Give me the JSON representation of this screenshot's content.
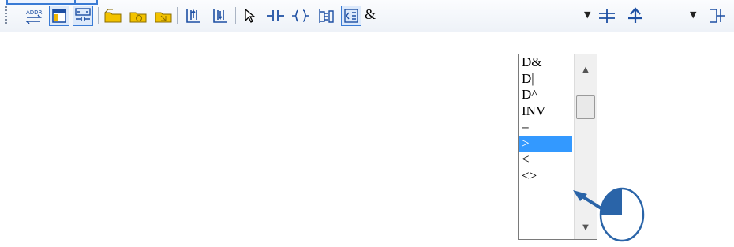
{
  "toolbar": {
    "buttons": [
      {
        "name": "addr-toggle-icon",
        "glyph": "⇆"
      },
      {
        "name": "window-icon",
        "glyph": "▣"
      },
      {
        "name": "contact-coil-icon",
        "glyph": "⊞"
      },
      {
        "name": "folder-icon",
        "glyph": "▰"
      },
      {
        "name": "folder-up-icon",
        "glyph": "▰"
      },
      {
        "name": "folder-down-icon",
        "glyph": "▰"
      },
      {
        "name": "insert-rung-above-icon",
        "glyph": "⫫"
      },
      {
        "name": "insert-rung-below-icon",
        "glyph": "⫫"
      },
      {
        "name": "select-pointer-icon",
        "glyph": "⇱"
      },
      {
        "name": "contact-icon",
        "glyph": "⊣⊢"
      },
      {
        "name": "coil-icon",
        "glyph": "{}"
      },
      {
        "name": "function-block-icon",
        "glyph": "⊏"
      },
      {
        "name": "compare-instruction-icon",
        "glyph": "⧉"
      }
    ],
    "instruction_text": "&",
    "right_icons": [
      "horizontal-line-icon",
      "vertical-line-icon",
      "block-bracket-icon"
    ]
  },
  "dropdown": {
    "items": [
      "D&",
      "D|",
      "D^",
      "INV",
      "=",
      ">",
      "<",
      "<>"
    ],
    "selected": ">"
  }
}
